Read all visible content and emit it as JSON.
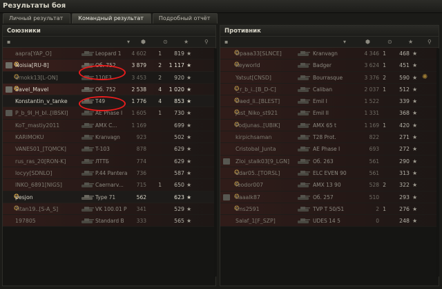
{
  "window": {
    "title": "Результаты боя"
  },
  "tabs": [
    {
      "label": "Личный результат",
      "active": false
    },
    {
      "label": "Командный результат",
      "active": true
    },
    {
      "label": "Подробный отчёт",
      "active": false
    }
  ],
  "allies": {
    "title": "Союзники",
    "rows": [
      {
        "name": "aapra[YAP_O]",
        "vehicle": "Leopard 1",
        "damage": "4 602",
        "kills": "1",
        "xp": "819",
        "badge": false,
        "medal": false,
        "dead": true,
        "red": true
      },
      {
        "name": "Noisia[RU-8]",
        "vehicle": "Об. 752",
        "damage": "3 879",
        "kills": "2",
        "xp": "1 117",
        "badge": true,
        "medal": true,
        "dead": false,
        "red": true
      },
      {
        "name": "arnokk13[L-ON]",
        "vehicle": "110E3",
        "damage": "3 453",
        "kills": "2",
        "xp": "920",
        "badge": false,
        "medal": true,
        "dead": true,
        "red": false
      },
      {
        "name": "Savel_Mavel",
        "vehicle": "Об. 752",
        "damage": "2 538",
        "kills": "4",
        "xp": "1 020",
        "badge": true,
        "medal": true,
        "dead": false,
        "red": true
      },
      {
        "name": "Konstantin_v_tanke",
        "vehicle": "T49",
        "damage": "1 776",
        "kills": "4",
        "xp": "853",
        "badge": false,
        "medal": false,
        "dead": false,
        "red": false
      },
      {
        "name": "P_b_9I_H_bI..[IBSKI]",
        "vehicle": "AE Phase I",
        "damage": "1 605",
        "kills": "1",
        "xp": "730",
        "badge": true,
        "medal": false,
        "dead": true,
        "red": true
      },
      {
        "name": "KoT_mastiy2011",
        "vehicle": "AMX C...",
        "damage": "1 169",
        "kills": "",
        "xp": "699",
        "badge": false,
        "medal": false,
        "dead": true,
        "red": true
      },
      {
        "name": "KARIMOKU",
        "vehicle": "Kranvagn",
        "damage": "923",
        "kills": "",
        "xp": "502",
        "badge": false,
        "medal": false,
        "dead": true,
        "red": true
      },
      {
        "name": "VANES01_[TQMCK]",
        "vehicle": "T-103",
        "damage": "878",
        "kills": "",
        "xp": "629",
        "badge": false,
        "medal": false,
        "dead": true,
        "red": true
      },
      {
        "name": "rus_ras_20[RON-K]",
        "vehicle": "ЛТТБ",
        "damage": "774",
        "kills": "",
        "xp": "629",
        "badge": false,
        "medal": false,
        "dead": true,
        "red": true
      },
      {
        "name": "locyy[SDNLO]",
        "vehicle": "P.44 Pantera",
        "damage": "736",
        "kills": "",
        "xp": "587",
        "badge": false,
        "medal": false,
        "dead": true,
        "red": true
      },
      {
        "name": "INKO_6891[NIGS]",
        "vehicle": "Caernarv...",
        "damage": "715",
        "kills": "1",
        "xp": "650",
        "badge": false,
        "medal": false,
        "dead": true,
        "red": true
      },
      {
        "name": "pesjon",
        "vehicle": "Type 71",
        "damage": "562",
        "kills": "",
        "xp": "623",
        "badge": false,
        "medal": true,
        "dead": false,
        "red": false
      },
      {
        "name": "Titan19..[S-A_S]",
        "vehicle": "VK 100.01 P",
        "damage": "341",
        "kills": "",
        "xp": "529",
        "badge": false,
        "medal": true,
        "dead": true,
        "red": true
      },
      {
        "name": "197805",
        "vehicle": "Standard B",
        "damage": "333",
        "kills": "",
        "xp": "565",
        "badge": false,
        "medal": false,
        "dead": true,
        "red": true
      }
    ]
  },
  "enemies": {
    "title": "Противник",
    "rows": [
      {
        "name": "Dpaaa33[SLNCE]",
        "vehicle": "Kranvagn",
        "damage": "4 346",
        "kills": "1",
        "xp": "468",
        "badge": false,
        "medal": true,
        "extra": false,
        "dead": true,
        "red": true
      },
      {
        "name": "Keyworld",
        "vehicle": "Badger",
        "damage": "3 624",
        "kills": "1",
        "xp": "451",
        "badge": false,
        "medal": true,
        "extra": false,
        "dead": true,
        "red": true
      },
      {
        "name": "Yatsut[CNSD]",
        "vehicle": "Bourrasque",
        "damage": "3 376",
        "kills": "2",
        "xp": "590",
        "badge": false,
        "medal": false,
        "extra": true,
        "dead": true,
        "red": true
      },
      {
        "name": "i_r_b_i..[B_D-C]",
        "vehicle": "Caliban",
        "damage": "2 037",
        "kills": "1",
        "xp": "512",
        "badge": false,
        "medal": true,
        "extra": false,
        "dead": true,
        "red": true
      },
      {
        "name": "Daed_li..[BLEST]",
        "vehicle": "Emil I",
        "damage": "1 522",
        "kills": "",
        "xp": "339",
        "badge": false,
        "medal": true,
        "extra": false,
        "dead": true,
        "red": true
      },
      {
        "name": "Just_Niko_st921",
        "vehicle": "Emil II",
        "damage": "1 331",
        "kills": "",
        "xp": "368",
        "badge": false,
        "medal": true,
        "extra": false,
        "dead": true,
        "red": true
      },
      {
        "name": "Podjunas..[UBIK]",
        "vehicle": "AMX 65 t",
        "damage": "1 169",
        "kills": "1",
        "xp": "420",
        "badge": false,
        "medal": true,
        "extra": false,
        "dead": true,
        "red": true
      },
      {
        "name": "kirpichsaman",
        "vehicle": "T28 Prot.",
        "damage": "822",
        "kills": "",
        "xp": "271",
        "badge": false,
        "medal": false,
        "extra": false,
        "dead": true,
        "red": true
      },
      {
        "name": "Cristobal_Junta",
        "vehicle": "AE Phase I",
        "damage": "693",
        "kills": "",
        "xp": "272",
        "badge": false,
        "medal": false,
        "extra": false,
        "dead": true,
        "red": true
      },
      {
        "name": "Zloi_stalk03[9_LGN]",
        "vehicle": "Об. 263",
        "damage": "561",
        "kills": "",
        "xp": "290",
        "badge": true,
        "medal": false,
        "extra": false,
        "dead": true,
        "red": true
      },
      {
        "name": "udar05..[TORSL]",
        "vehicle": "ELC EVEN 90",
        "damage": "561",
        "kills": "",
        "xp": "313",
        "badge": false,
        "medal": true,
        "extra": false,
        "dead": true,
        "red": true
      },
      {
        "name": "feodor007",
        "vehicle": "AMX 13 90",
        "damage": "528",
        "kills": "2",
        "xp": "322",
        "badge": false,
        "medal": true,
        "extra": false,
        "dead": true,
        "red": true
      },
      {
        "name": "haaalk87",
        "vehicle": "Об. 257",
        "damage": "510",
        "kills": "",
        "xp": "293",
        "badge": true,
        "medal": true,
        "extra": false,
        "dead": true,
        "red": true
      },
      {
        "name": "tms2591",
        "vehicle": "TVP T 50/51",
        "damage": "2",
        "kills": "1",
        "xp": "276",
        "badge": false,
        "medal": true,
        "extra": false,
        "dead": true,
        "red": true
      },
      {
        "name": "Salaf_1[F_SZP]",
        "vehicle": "UDES 14 5",
        "damage": "0",
        "kills": "",
        "xp": "248",
        "badge": false,
        "medal": false,
        "extra": false,
        "dead": true,
        "red": true
      }
    ]
  },
  "icons": {
    "header": [
      "badge-icon",
      "tank-type-icon",
      "damage-icon",
      "kills-icon",
      "xp-star-icon",
      "status-icon"
    ],
    "row_star": "★",
    "medal": "✪",
    "extra": "✺"
  },
  "colors": {
    "highlight_ring": "#e81d1d",
    "red_row": "#3a1f1c"
  }
}
